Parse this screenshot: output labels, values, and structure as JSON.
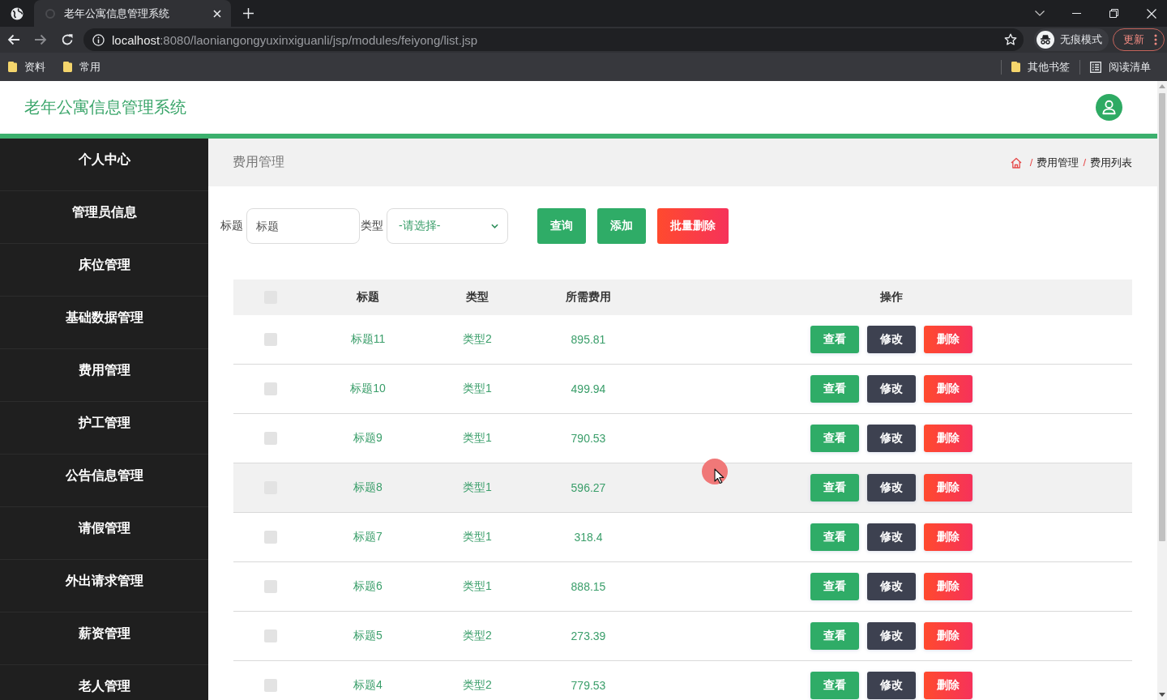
{
  "browser": {
    "tabs": [
      {
        "title": "老年公寓信息管理系统",
        "selected": true
      }
    ],
    "url_host": "localhost",
    "url_rest": ":8080/laoniangongyuxinxiguanli/jsp/modules/feiyong/list.jsp",
    "profile": "无痕模式",
    "update": "更新",
    "bookmarks": [
      {
        "label": "资料",
        "kind": "folder"
      },
      {
        "label": "常用",
        "kind": "folder"
      }
    ],
    "bookmarks_right": [
      {
        "label": "其他书签",
        "kind": "folder"
      },
      {
        "label": "阅读清单",
        "kind": "reading-list"
      }
    ]
  },
  "header": {
    "title": "老年公寓信息管理系统"
  },
  "sidebar": {
    "items": [
      "个人中心",
      "管理员信息",
      "床位管理",
      "基础数据管理",
      "费用管理",
      "护工管理",
      "公告信息管理",
      "请假管理",
      "外出请求管理",
      "薪资管理",
      "老人管理"
    ]
  },
  "content": {
    "title": "费用管理",
    "breadcrumb": [
      {
        "sep": "/",
        "label": "费用管理"
      },
      {
        "sep": "/",
        "label": "费用列表"
      }
    ]
  },
  "search": {
    "fields": [
      {
        "label": "标题",
        "kind": "input",
        "placeholder": "标题"
      },
      {
        "label": "类型",
        "kind": "select",
        "value": "-请选择-"
      }
    ],
    "buttons": [
      {
        "label": "查询",
        "kind": "query"
      },
      {
        "label": "添加",
        "kind": "add"
      },
      {
        "label": "批量删除",
        "kind": "delete"
      }
    ]
  },
  "table": {
    "select_all_checked": false,
    "columns": [
      "标题",
      "类型",
      "所需费用",
      "操作"
    ],
    "rows": [
      {
        "title": "标题11",
        "type": "类型2",
        "cost": "895.81",
        "checked": false,
        "highlighted": false,
        "actions": [
          {
            "label": "查看",
            "kind": "view"
          },
          {
            "label": "修改",
            "kind": "edit"
          },
          {
            "label": "删除",
            "kind": "delete"
          }
        ]
      },
      {
        "title": "标题10",
        "type": "类型1",
        "cost": "499.94",
        "checked": false,
        "highlighted": false,
        "actions": [
          {
            "label": "查看",
            "kind": "view"
          },
          {
            "label": "修改",
            "kind": "edit"
          },
          {
            "label": "删除",
            "kind": "delete"
          }
        ]
      },
      {
        "title": "标题9",
        "type": "类型1",
        "cost": "790.53",
        "checked": false,
        "highlighted": false,
        "actions": [
          {
            "label": "查看",
            "kind": "view"
          },
          {
            "label": "修改",
            "kind": "edit"
          },
          {
            "label": "删除",
            "kind": "delete"
          }
        ]
      },
      {
        "title": "标题8",
        "type": "类型1",
        "cost": "596.27",
        "checked": false,
        "highlighted": true,
        "actions": [
          {
            "label": "查看",
            "kind": "view"
          },
          {
            "label": "修改",
            "kind": "edit"
          },
          {
            "label": "删除",
            "kind": "delete"
          }
        ]
      },
      {
        "title": "标题7",
        "type": "类型1",
        "cost": "318.4",
        "checked": false,
        "highlighted": false,
        "actions": [
          {
            "label": "查看",
            "kind": "view"
          },
          {
            "label": "修改",
            "kind": "edit"
          },
          {
            "label": "删除",
            "kind": "delete"
          }
        ]
      },
      {
        "title": "标题6",
        "type": "类型1",
        "cost": "888.15",
        "checked": false,
        "highlighted": false,
        "actions": [
          {
            "label": "查看",
            "kind": "view"
          },
          {
            "label": "修改",
            "kind": "edit"
          },
          {
            "label": "删除",
            "kind": "delete"
          }
        ]
      },
      {
        "title": "标题5",
        "type": "类型2",
        "cost": "273.39",
        "checked": false,
        "highlighted": false,
        "actions": [
          {
            "label": "查看",
            "kind": "view"
          },
          {
            "label": "修改",
            "kind": "edit"
          },
          {
            "label": "删除",
            "kind": "delete"
          }
        ]
      },
      {
        "title": "标题4",
        "type": "类型2",
        "cost": "779.53",
        "checked": false,
        "highlighted": false,
        "actions": [
          {
            "label": "查看",
            "kind": "view"
          },
          {
            "label": "修改",
            "kind": "edit"
          },
          {
            "label": "删除",
            "kind": "delete"
          }
        ]
      }
    ]
  }
}
